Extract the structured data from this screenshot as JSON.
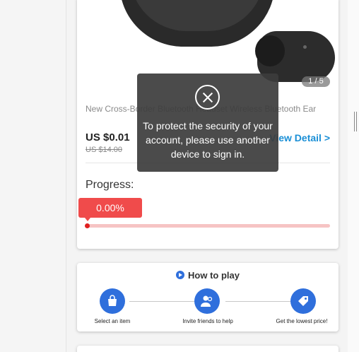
{
  "product": {
    "image_counter": "1 / 5",
    "title": "New Cross-Border Bluetooth Headset Wireless Bluetooth Ear",
    "price": "US $0.01",
    "original_price": "US $14.00",
    "view_detail": "View Detail >"
  },
  "progress": {
    "label": "Progress:",
    "value_text": "0.00%",
    "fraction": 0
  },
  "how_to_play": {
    "title": "How to play",
    "steps": [
      {
        "label": "Select an item",
        "icon": "shopping-bag-icon"
      },
      {
        "label": "Invite friends to help",
        "icon": "friends-icon"
      },
      {
        "label": "Get the lowest price!",
        "icon": "price-tag-icon"
      }
    ]
  },
  "overlay": {
    "message": "To protect the security of your account, please use another device to sign in."
  },
  "colors": {
    "accent_red": "#f04b4b",
    "link_blue": "#1a8fd6",
    "step_blue": "#2f6fdc"
  }
}
